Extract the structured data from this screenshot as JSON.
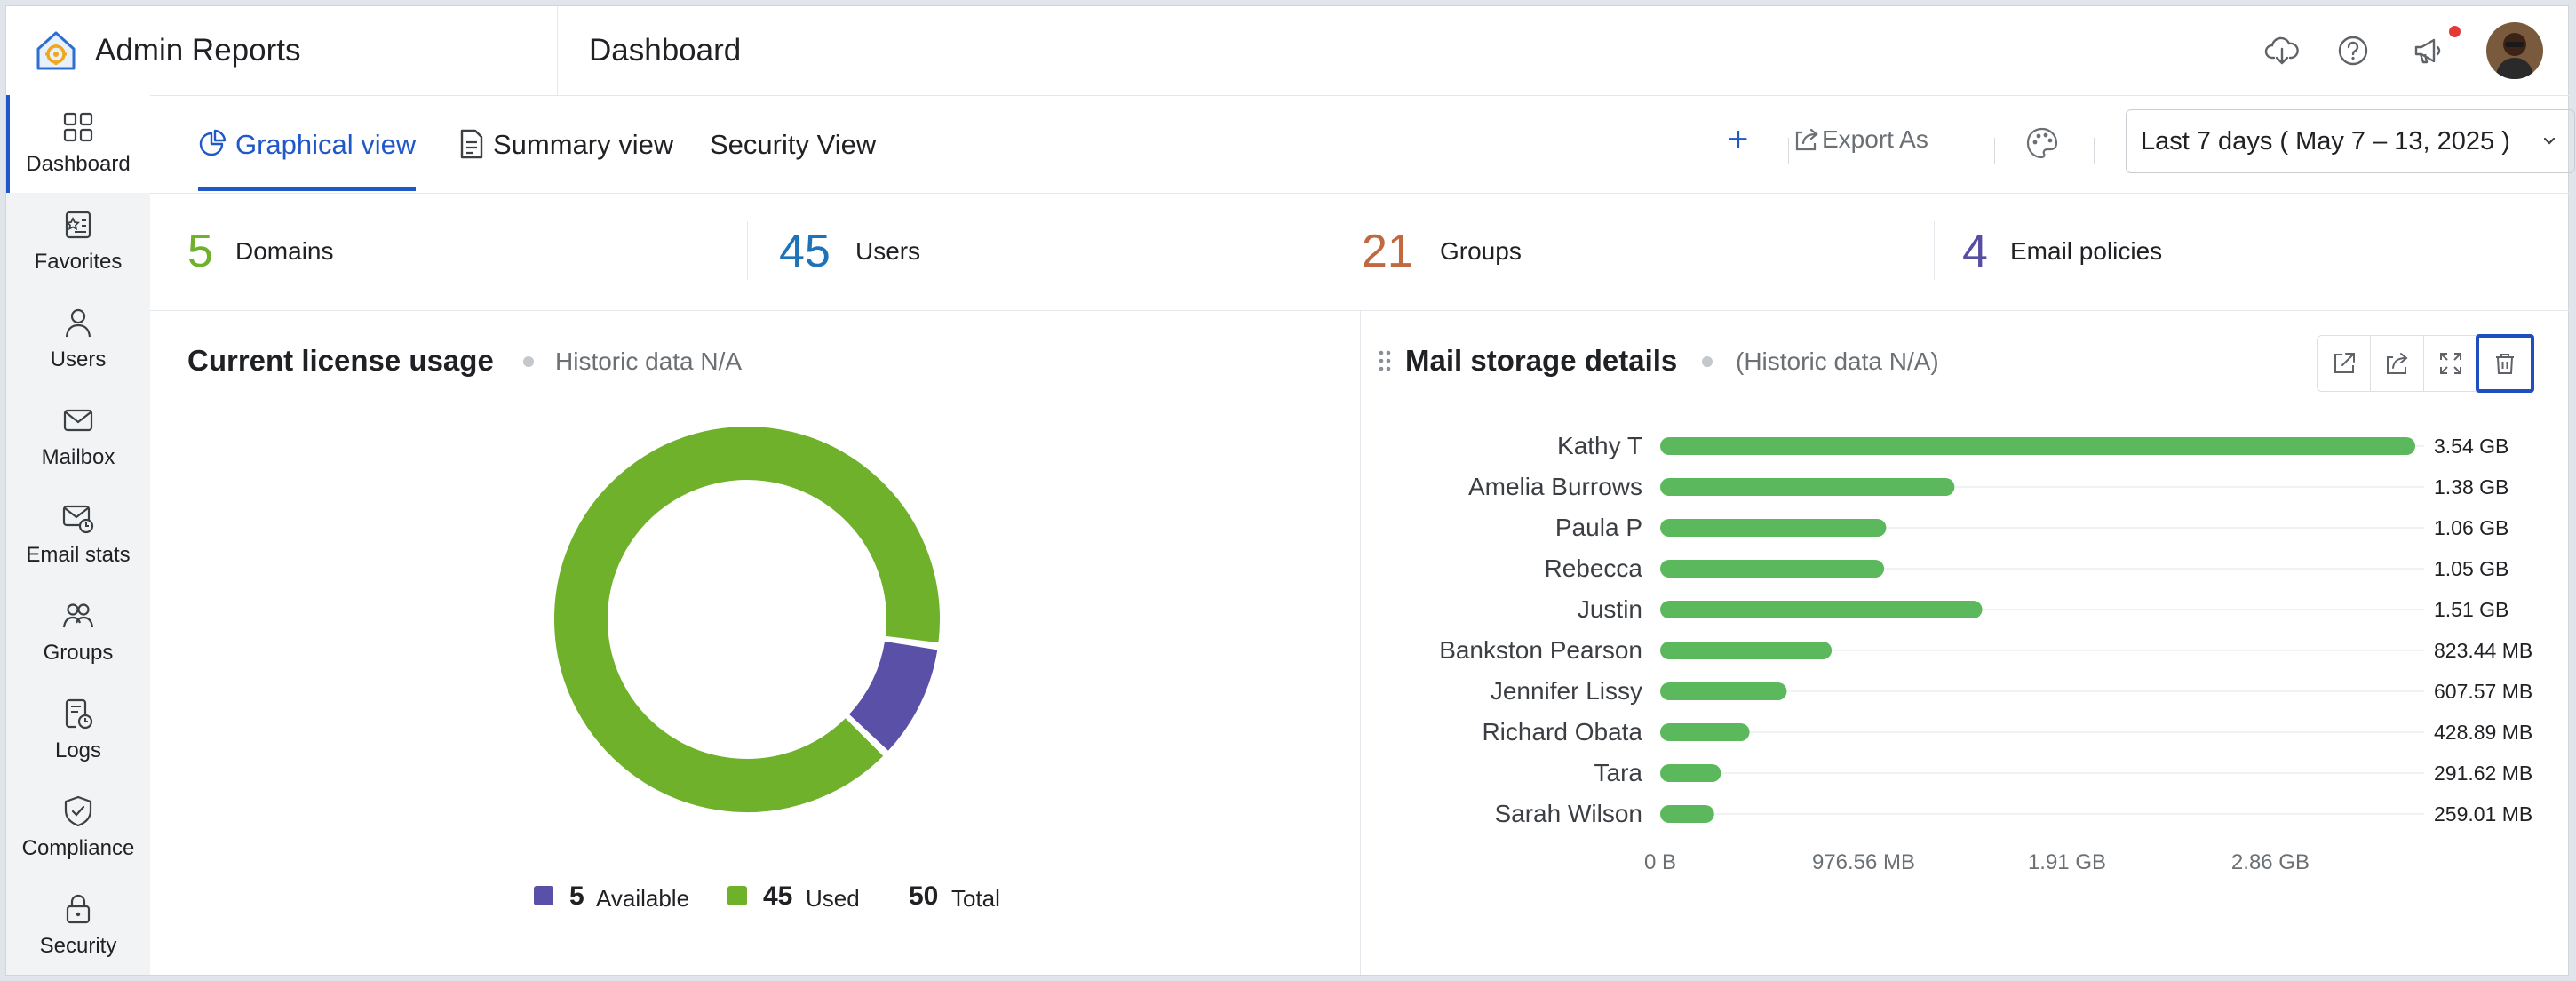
{
  "app": {
    "name": "Admin Reports",
    "page_title": "Dashboard"
  },
  "topbar_icons": [
    "download-cloud-icon",
    "help-icon",
    "announcement-icon",
    "avatar"
  ],
  "sidebar": {
    "items": [
      {
        "label": "Dashboard",
        "icon": "grid-icon",
        "active": true
      },
      {
        "label": "Favorites",
        "icon": "favorites-icon"
      },
      {
        "label": "Users",
        "icon": "user-icon"
      },
      {
        "label": "Mailbox",
        "icon": "mail-icon"
      },
      {
        "label": "Email stats",
        "icon": "mail-stats-icon"
      },
      {
        "label": "Groups",
        "icon": "groups-icon"
      },
      {
        "label": "Logs",
        "icon": "logs-icon"
      },
      {
        "label": "Compliance",
        "icon": "shield-icon"
      },
      {
        "label": "Security",
        "icon": "lock-icon"
      }
    ]
  },
  "tabs": [
    {
      "label": "Graphical view",
      "icon": "pie-chart-icon",
      "active": true
    },
    {
      "label": "Summary view",
      "icon": "document-icon"
    },
    {
      "label": "Security View"
    }
  ],
  "toolbar": {
    "add_label": "+",
    "export_label": "Export As",
    "date_range": "Last 7 days ( May 7 – 13, 2025 )"
  },
  "stats": [
    {
      "value": "5",
      "label": "Domains",
      "color": "#6fb12b"
    },
    {
      "value": "45",
      "label": "Users",
      "color": "#1e73b8"
    },
    {
      "value": "21",
      "label": "Groups",
      "color": "#c0683f"
    },
    {
      "value": "4",
      "label": "Email policies",
      "color": "#574ea3"
    }
  ],
  "license_panel": {
    "title": "Current license usage",
    "subtitle": "Historic data N/A",
    "legend": [
      {
        "value": "5",
        "label": "Available",
        "color": "#5a50a8"
      },
      {
        "value": "45",
        "label": "Used",
        "color": "#6fb12b"
      },
      {
        "value": "50",
        "label": "Total"
      }
    ]
  },
  "storage_panel": {
    "title": "Mail storage details",
    "subtitle": "(Historic data N/A)",
    "actions": [
      "open-external-icon",
      "share-icon",
      "expand-icon",
      "delete-icon"
    ]
  },
  "chart_data": [
    {
      "type": "pie",
      "donut": true,
      "slices": [
        {
          "label": "Available",
          "value": 5,
          "color": "#5a50a8"
        },
        {
          "label": "Used",
          "value": 45,
          "color": "#6fb12b"
        }
      ],
      "total": 50
    },
    {
      "type": "bar",
      "orientation": "horizontal",
      "color": "#5cb85c",
      "categories": [
        "Kathy T",
        "Amelia Burrows",
        "Paula P",
        "Rebecca",
        "Justin",
        "Bankston Pearson",
        "Jennifer Lissy",
        "Richard Obata",
        "Tara",
        "Sarah Wilson"
      ],
      "values_mb": [
        3625,
        1413,
        1085,
        1075,
        1546,
        823.44,
        607.57,
        428.89,
        291.62,
        259.01
      ],
      "value_labels": [
        "3.54 GB",
        "1.38 GB",
        "1.06 GB",
        "1.05 GB",
        "1.51 GB",
        "823.44 MB",
        "607.57 MB",
        "428.89 MB",
        "291.62 MB",
        "259.01 MB"
      ],
      "x_ticks": [
        "0 B",
        "976.56 MB",
        "1.91 GB",
        "2.86 GB"
      ],
      "x_tick_values_mb": [
        0,
        976.56,
        1953.12,
        2929.68
      ],
      "xlim_mb": [
        0,
        3625
      ]
    }
  ]
}
